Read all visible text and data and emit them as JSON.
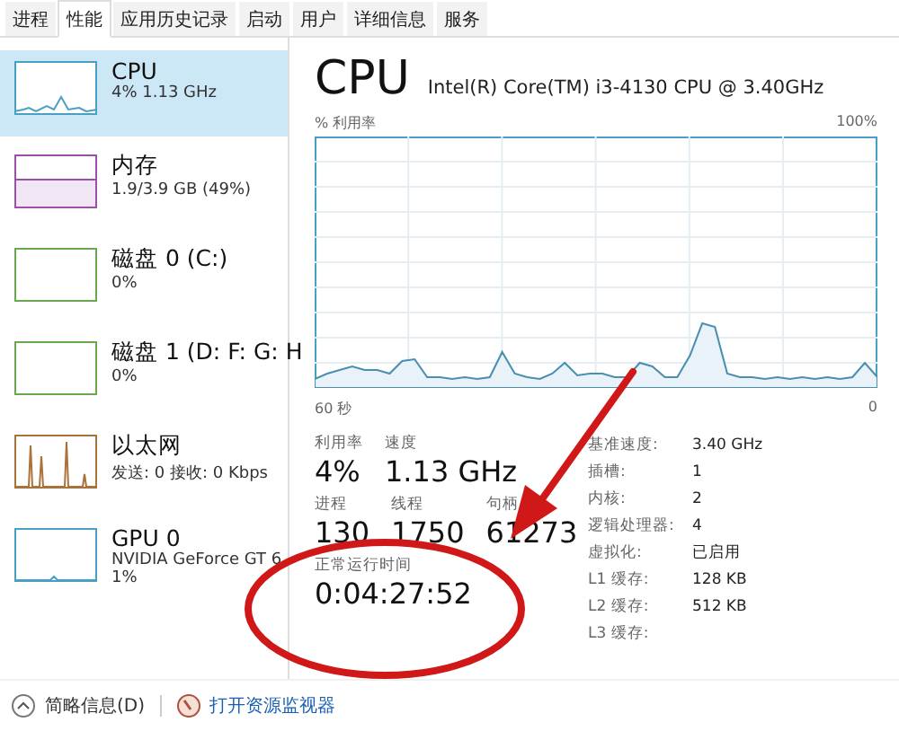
{
  "tabs": [
    {
      "label": "进程",
      "selected": false
    },
    {
      "label": "性能",
      "selected": true
    },
    {
      "label": "应用历史记录",
      "selected": false
    },
    {
      "label": "启动",
      "selected": false
    },
    {
      "label": "用户",
      "selected": false
    },
    {
      "label": "详细信息",
      "selected": false
    },
    {
      "label": "服务",
      "selected": false
    }
  ],
  "sidebar": {
    "items": [
      {
        "kind": "cpu",
        "title": "CPU",
        "lines": [
          "4% 1.13 GHz"
        ],
        "selected": true,
        "color": "#4a9fc4"
      },
      {
        "kind": "memory",
        "title": "内存",
        "lines": [
          "1.9/3.9 GB (49%)"
        ],
        "selected": false,
        "color": "#9b4fa8"
      },
      {
        "kind": "disk",
        "title": "磁盘 0 (C:)",
        "lines": [
          "0%"
        ],
        "selected": false,
        "color": "#6aa84f"
      },
      {
        "kind": "disk",
        "title": "磁盘 1 (D: F: G: H",
        "lines": [
          "0%"
        ],
        "selected": false,
        "color": "#6aa84f"
      },
      {
        "kind": "network",
        "title": "以太网",
        "lines": [
          "发送: 0 接收: 0 Kbps"
        ],
        "selected": false,
        "color": "#a8733a"
      },
      {
        "kind": "gpu",
        "title": "GPU 0",
        "lines": [
          "NVIDIA GeForce GT 6",
          "1%"
        ],
        "selected": false,
        "color": "#4a9fc4"
      }
    ]
  },
  "detail": {
    "title": "CPU",
    "model": "Intel(R) Core(TM) i3-4130 CPU @ 3.40GHz",
    "y_label": "% 利用率",
    "y_max": "100%",
    "x_label": "60 秒",
    "x_min": "0",
    "stats": [
      [
        {
          "label": "利用率",
          "value": "4%"
        },
        {
          "label": "速度",
          "value": "1.13 GHz"
        }
      ],
      [
        {
          "label": "进程",
          "value": "130"
        },
        {
          "label": "线程",
          "value": "1750"
        },
        {
          "label": "句柄",
          "value": "61273"
        }
      ]
    ],
    "uptime": {
      "label": "正常运行时间",
      "value": "0:04:27:52"
    },
    "specs": [
      {
        "label": "基准速度:",
        "value": "3.40 GHz"
      },
      {
        "label": "插槽:",
        "value": "1"
      },
      {
        "label": "内核:",
        "value": "2"
      },
      {
        "label": "逻辑处理器:",
        "value": "4"
      },
      {
        "label": "虚拟化:",
        "value": "已启用"
      },
      {
        "label": "L1 缓存:",
        "value": "128 KB"
      },
      {
        "label": "L2 缓存:",
        "value": "512 KB"
      },
      {
        "label": "L3 缓存:"
      }
    ]
  },
  "footer": {
    "summary": "简略信息(D)",
    "monitor_link": "打开资源监视器"
  }
}
